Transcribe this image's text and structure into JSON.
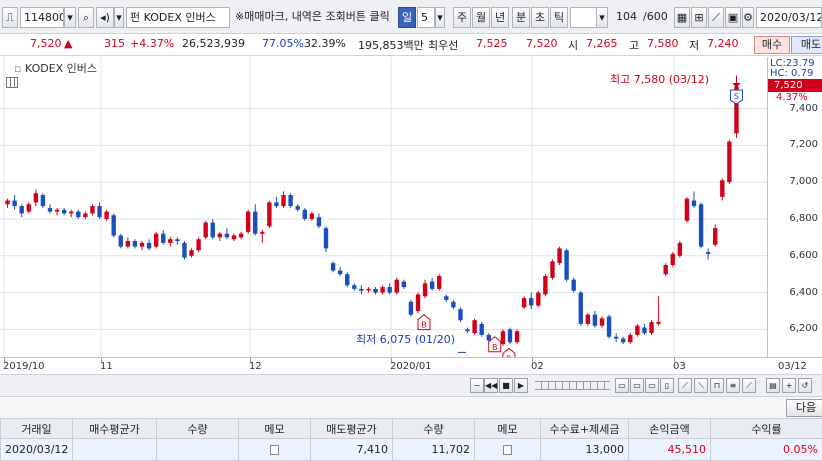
{
  "toolbar": {
    "code": "114800",
    "name": "KODEX 인버스",
    "name_prefix": "펀",
    "marquee": "※매매마크, 내역은 조회버튼 클릭",
    "periods": [
      "일",
      "5",
      "주",
      "월",
      "년",
      "분",
      "초",
      "틱"
    ],
    "active_period": "일",
    "count": "104",
    "count_total": "/600",
    "date": "2020/03/12"
  },
  "price": {
    "current": "7,520",
    "arrow": "▲",
    "change": "315",
    "change_pct": "+4.37%",
    "volume": "26,523,939",
    "vol_ratio": "77.05%",
    "turnover_pct": "32.39%",
    "amount": "195,853백만",
    "priority_label": "최우선",
    "ask": "7,525",
    "bid": "7,520",
    "open_label": "시",
    "open": "7,265",
    "high_label": "고",
    "high": "7,580",
    "low_label": "저",
    "low": "7,240",
    "buy_label": "매수",
    "sell_label": "매도"
  },
  "chart": {
    "title": "KODEX 인버스",
    "lc_label": "LC:23.79",
    "hc_label": "HC: 0.79",
    "last_price": "7,520",
    "last_change": "4.37%",
    "high_note": "최고 7,580 (03/12)",
    "low_note": "최저 6,075 (01/20)",
    "sell_marker": "S",
    "buy_marker": "B",
    "colors": {
      "up": "#d0021b",
      "down": "#1b4fbf",
      "grid": "#dfe3e8"
    }
  },
  "chart_data": {
    "type": "candlestick",
    "ylim": [
      6050,
      7680
    ],
    "y_ticks": [
      "7,400",
      "7,200",
      "7,000",
      "6,800",
      "6,600",
      "6,400",
      "6,200"
    ],
    "x_ticks": [
      "2019/10",
      "11",
      "12",
      "2020/01",
      "02",
      "03",
      "03/12"
    ],
    "candles": [
      [
        6880,
        6910,
        6860,
        6900
      ],
      [
        6900,
        6930,
        6850,
        6870
      ],
      [
        6870,
        6880,
        6810,
        6830
      ],
      [
        6840,
        6890,
        6830,
        6880
      ],
      [
        6890,
        6960,
        6870,
        6940
      ],
      [
        6930,
        6940,
        6860,
        6870
      ],
      [
        6860,
        6880,
        6830,
        6840
      ],
      [
        6840,
        6860,
        6820,
        6850
      ],
      [
        6850,
        6860,
        6820,
        6830
      ],
      [
        6830,
        6850,
        6810,
        6840
      ],
      [
        6840,
        6850,
        6800,
        6810
      ],
      [
        6810,
        6840,
        6800,
        6830
      ],
      [
        6830,
        6880,
        6820,
        6870
      ],
      [
        6870,
        6890,
        6800,
        6810
      ],
      [
        6800,
        6850,
        6790,
        6840
      ],
      [
        6820,
        6830,
        6700,
        6710
      ],
      [
        6710,
        6720,
        6640,
        6650
      ],
      [
        6650,
        6700,
        6640,
        6680
      ],
      [
        6680,
        6690,
        6640,
        6650
      ],
      [
        6650,
        6680,
        6630,
        6670
      ],
      [
        6670,
        6690,
        6630,
        6640
      ],
      [
        6650,
        6730,
        6640,
        6720
      ],
      [
        6720,
        6740,
        6660,
        6670
      ],
      [
        6670,
        6700,
        6650,
        6690
      ],
      [
        6690,
        6700,
        6660,
        6680
      ],
      [
        6670,
        6680,
        6580,
        6590
      ],
      [
        6600,
        6640,
        6590,
        6630
      ],
      [
        6630,
        6700,
        6620,
        6690
      ],
      [
        6700,
        6790,
        6690,
        6780
      ],
      [
        6780,
        6800,
        6690,
        6700
      ],
      [
        6700,
        6730,
        6680,
        6720
      ],
      [
        6720,
        6750,
        6690,
        6700
      ],
      [
        6690,
        6720,
        6680,
        6710
      ],
      [
        6700,
        6730,
        6690,
        6720
      ],
      [
        6730,
        6850,
        6720,
        6840
      ],
      [
        6840,
        6880,
        6710,
        6720
      ],
      [
        6720,
        6740,
        6670,
        6730
      ],
      [
        6760,
        6900,
        6750,
        6890
      ],
      [
        6890,
        6920,
        6860,
        6870
      ],
      [
        6870,
        6950,
        6860,
        6930
      ],
      [
        6930,
        6940,
        6860,
        6870
      ],
      [
        6870,
        6880,
        6840,
        6850
      ],
      [
        6850,
        6860,
        6790,
        6800
      ],
      [
        6800,
        6840,
        6790,
        6830
      ],
      [
        6810,
        6830,
        6750,
        6760
      ],
      [
        6750,
        6760,
        6620,
        6640
      ],
      [
        6560,
        6570,
        6510,
        6520
      ],
      [
        6520,
        6540,
        6490,
        6500
      ],
      [
        6500,
        6510,
        6430,
        6440
      ],
      [
        6440,
        6450,
        6410,
        6420
      ],
      [
        6420,
        6440,
        6390,
        6410
      ],
      [
        6420,
        6430,
        6400,
        6420
      ],
      [
        6420,
        6430,
        6390,
        6400
      ],
      [
        6400,
        6440,
        6390,
        6430
      ],
      [
        6430,
        6450,
        6390,
        6400
      ],
      [
        6400,
        6480,
        6390,
        6470
      ],
      [
        6460,
        6470,
        6420,
        6430
      ],
      [
        6350,
        6360,
        6270,
        6280
      ],
      [
        6300,
        6400,
        6290,
        6390
      ],
      [
        6380,
        6470,
        6370,
        6450
      ],
      [
        6460,
        6480,
        6410,
        6420
      ],
      [
        6420,
        6500,
        6410,
        6490
      ],
      [
        6380,
        6390,
        6350,
        6360
      ],
      [
        6350,
        6360,
        6310,
        6320
      ],
      [
        6310,
        6320,
        6240,
        6250
      ],
      [
        6200,
        6210,
        6180,
        6190
      ],
      [
        6180,
        6260,
        6170,
        6250
      ],
      [
        6230,
        6240,
        6160,
        6170
      ],
      [
        6170,
        6180,
        6120,
        6140
      ],
      [
        6140,
        6150,
        6090,
        6100
      ],
      [
        6120,
        6200,
        6110,
        6190
      ],
      [
        6200,
        6210,
        6120,
        6130
      ],
      [
        6130,
        6200,
        6120,
        6190
      ],
      [
        6320,
        6380,
        6310,
        6370
      ],
      [
        6370,
        6400,
        6310,
        6330
      ],
      [
        6330,
        6410,
        6320,
        6400
      ],
      [
        6390,
        6500,
        6380,
        6490
      ],
      [
        6480,
        6580,
        6470,
        6570
      ],
      [
        6560,
        6650,
        6550,
        6640
      ],
      [
        6630,
        6640,
        6460,
        6470
      ],
      [
        6470,
        6480,
        6400,
        6410
      ],
      [
        6400,
        6410,
        6220,
        6230
      ],
      [
        6230,
        6290,
        6220,
        6280
      ],
      [
        6280,
        6300,
        6210,
        6220
      ],
      [
        6220,
        6270,
        6210,
        6260
      ],
      [
        6270,
        6280,
        6150,
        6160
      ],
      [
        6160,
        6180,
        6130,
        6150
      ],
      [
        6150,
        6160,
        6120,
        6130
      ],
      [
        6130,
        6180,
        6120,
        6170
      ],
      [
        6170,
        6230,
        6160,
        6220
      ],
      [
        6210,
        6230,
        6170,
        6180
      ],
      [
        6180,
        6250,
        6170,
        6240
      ],
      [
        6230,
        6380,
        6220,
        6240
      ],
      [
        6500,
        6560,
        6490,
        6550
      ],
      [
        6550,
        6620,
        6540,
        6610
      ],
      [
        6600,
        6680,
        6590,
        6670
      ],
      [
        6790,
        6920,
        6780,
        6910
      ],
      [
        6900,
        6950,
        6860,
        6870
      ],
      [
        6880,
        6890,
        6640,
        6650
      ],
      [
        6620,
        6640,
        6580,
        6610
      ],
      [
        6660,
        6770,
        6650,
        6750
      ],
      [
        6920,
        7020,
        6900,
        7010
      ],
      [
        7000,
        7230,
        6990,
        7220
      ],
      [
        7265,
        7580,
        7240,
        7520
      ]
    ]
  },
  "nav": {
    "icons": [
      "zoom-out",
      "prev",
      "stop",
      "next",
      "pause",
      "scroll",
      "zoom-in",
      "chart-setting",
      "indicator",
      "compare",
      "draw",
      "save",
      "print",
      "magnet",
      "trend",
      "close"
    ]
  },
  "table": {
    "next_label": "다음",
    "headers": [
      "거래일",
      "매수평균가",
      "수량",
      "메모",
      "매도평균가",
      "수량",
      "메모",
      "수수료+제세금",
      "손익금액",
      "수익률"
    ],
    "row": {
      "date": "2020/03/12",
      "buy_avg": "",
      "buy_qty": "",
      "sell_avg": "7,410",
      "sell_qty": "11,702",
      "fee": "13,000",
      "pnl": "45,510",
      "ret": "0.05%"
    }
  }
}
